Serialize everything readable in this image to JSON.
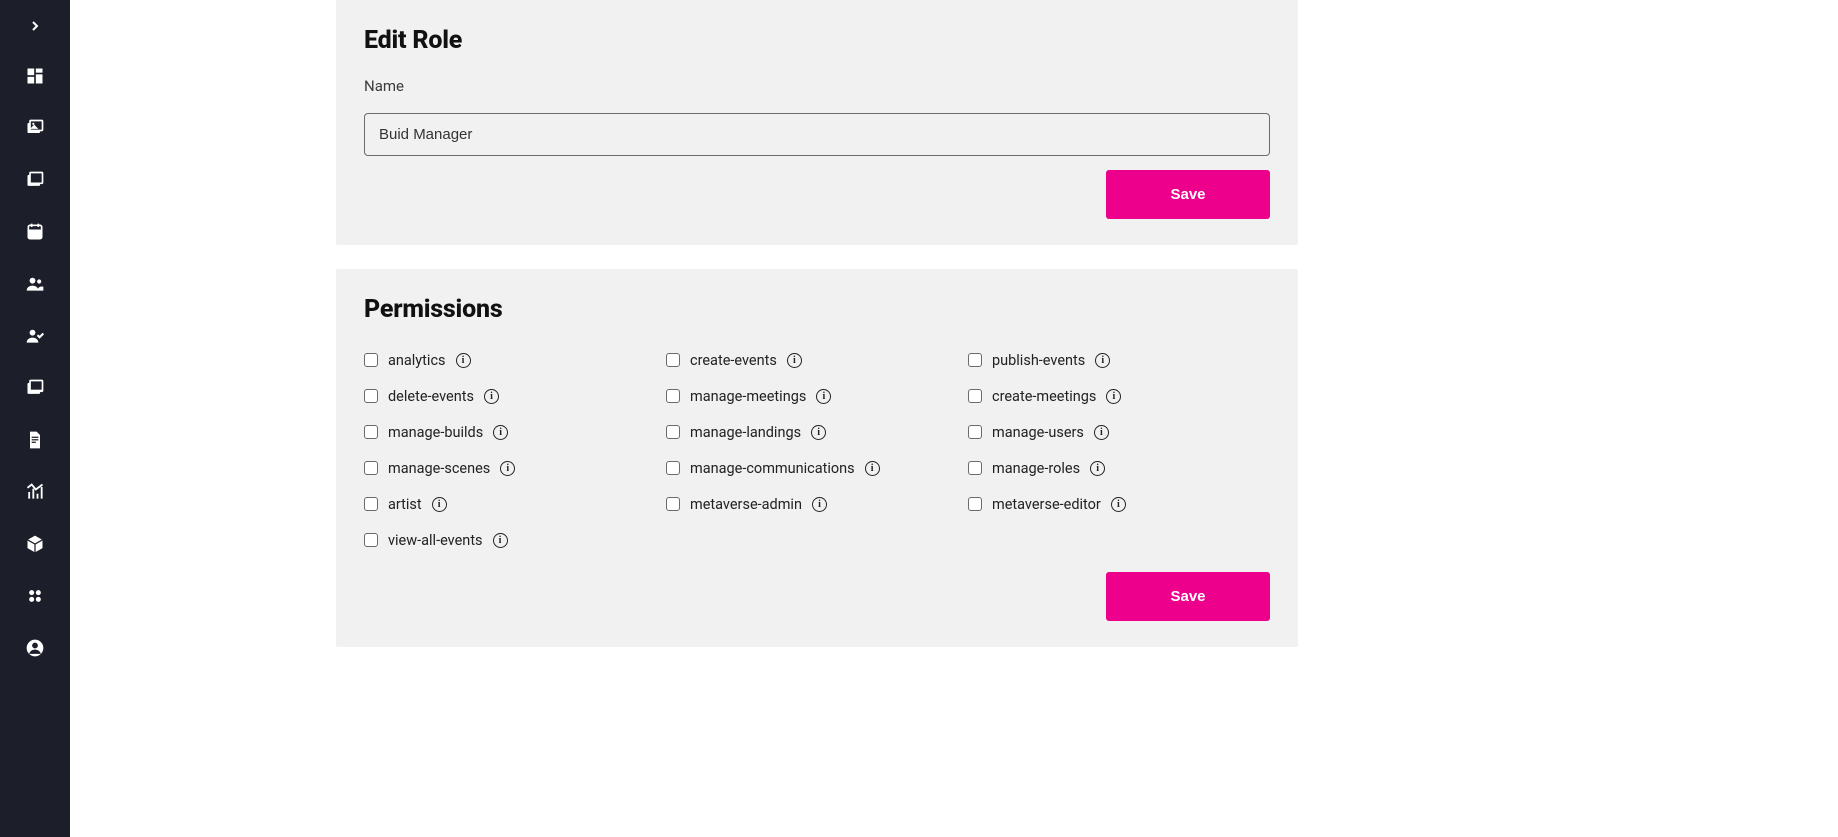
{
  "sidebar": {
    "expand_icon": "chevron-right",
    "items": [
      "dashboard-icon",
      "image-folder-icon",
      "media-library-icon",
      "calendar-file-icon",
      "users-icon",
      "user-check-icon",
      "book-media-icon",
      "document-icon",
      "chart-icon",
      "box-icon",
      "grid-dots-icon",
      "account-icon"
    ]
  },
  "edit_role": {
    "title": "Edit Role",
    "name_label": "Name",
    "name_value": "Buid Manager",
    "save_label": "Save"
  },
  "permissions": {
    "title": "Permissions",
    "save_label": "Save",
    "items": [
      {
        "key": "analytics",
        "label": "analytics",
        "checked": false
      },
      {
        "key": "create-events",
        "label": "create-events",
        "checked": false
      },
      {
        "key": "publish-events",
        "label": "publish-events",
        "checked": false
      },
      {
        "key": "delete-events",
        "label": "delete-events",
        "checked": false
      },
      {
        "key": "manage-meetings",
        "label": "manage-meetings",
        "checked": false
      },
      {
        "key": "create-meetings",
        "label": "create-meetings",
        "checked": false
      },
      {
        "key": "manage-builds",
        "label": "manage-builds",
        "checked": false
      },
      {
        "key": "manage-landings",
        "label": "manage-landings",
        "checked": false
      },
      {
        "key": "manage-users",
        "label": "manage-users",
        "checked": false
      },
      {
        "key": "manage-scenes",
        "label": "manage-scenes",
        "checked": false
      },
      {
        "key": "manage-communications",
        "label": "manage-communications",
        "checked": false
      },
      {
        "key": "manage-roles",
        "label": "manage-roles",
        "checked": false
      },
      {
        "key": "artist",
        "label": "artist",
        "checked": false
      },
      {
        "key": "metaverse-admin",
        "label": "metaverse-admin",
        "checked": false
      },
      {
        "key": "metaverse-editor",
        "label": "metaverse-editor",
        "checked": false
      },
      {
        "key": "view-all-events",
        "label": "view-all-events",
        "checked": false
      }
    ]
  },
  "colors": {
    "sidebar_bg": "#1c1f2a",
    "panel_bg": "#f1f1f1",
    "primary": "#ec008c"
  }
}
